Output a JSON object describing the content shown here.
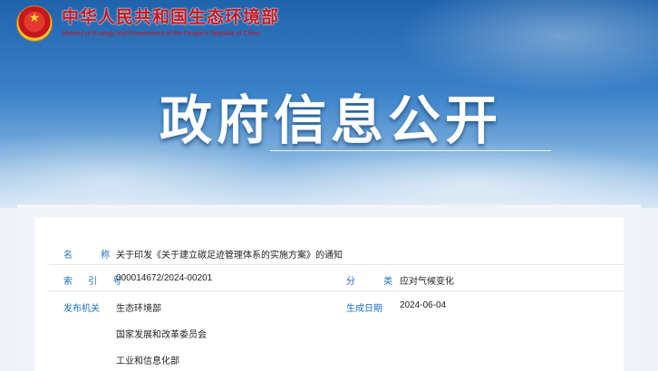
{
  "header": {
    "org_name_cn": "中华人民共和国生态环境部",
    "org_name_en": "Ministry of Ecology and Environment of the People's Republic of China",
    "hero_title": "政府信息公开"
  },
  "info": {
    "name_label": "名 称",
    "name_value": "关于印发《关于建立碳足迹管理体系的实施方案》的通知",
    "index_label": "索 引 号",
    "index_value": "000014672/2024-00201",
    "category_label": "分 类",
    "category_value": "应对气候变化",
    "issuer_label": "发布机关",
    "issuers": [
      "生态环境部",
      "国家发展和改革委员会",
      "工业和信息化部"
    ],
    "date_label": "生成日期",
    "date_value": "2024-06-04"
  }
}
